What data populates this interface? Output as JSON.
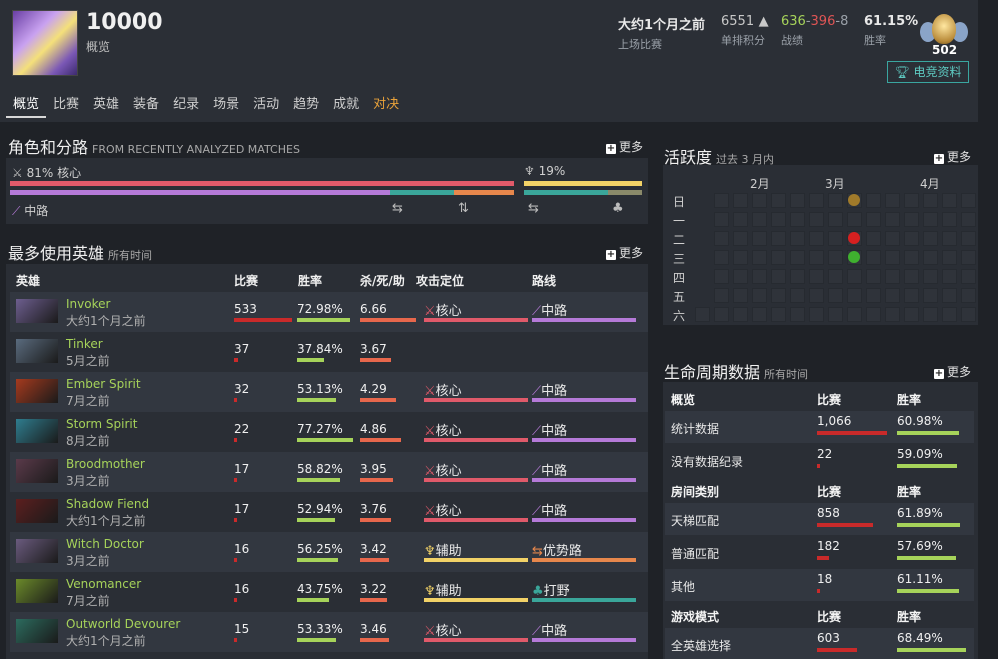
{
  "player": {
    "name": "10000",
    "subtitle": "概览"
  },
  "stats": {
    "last_match": {
      "value": "大约1个月之前",
      "label": "上场比赛"
    },
    "solo_mmr": {
      "value": "6551",
      "label": "单排积分"
    },
    "record": {
      "wins": "636",
      "losses": "396",
      "abandons": "8",
      "label": "战绩"
    },
    "winrate": {
      "value": "61.15%",
      "label": "胜率"
    },
    "rank_number": "502",
    "esports_button": "电竞资料"
  },
  "tabs": [
    "概览",
    "比赛",
    "英雄",
    "装备",
    "纪录",
    "场景",
    "活动",
    "趋势",
    "成就",
    "对决"
  ],
  "roles": {
    "title": "角色和分路",
    "subtitle": "FROM RECENTLY ANALYZED MATCHES",
    "more": "更多",
    "core_label": "81% 核心",
    "support_label": "19%",
    "lane_label": "中路",
    "colors": {
      "core": "#e05a6a",
      "mid": "#b57ad8",
      "support": "#f2d267",
      "jungle": "#3aa69a",
      "safe": "#e7874c"
    }
  },
  "heroes": {
    "title": "最多使用英雄",
    "subtitle": "所有时间",
    "more": "更多",
    "columns": [
      "英雄",
      "比赛",
      "胜率",
      "杀/死/助",
      "攻击定位",
      "路线"
    ],
    "rows": [
      {
        "name": "Invoker",
        "time": "大约1个月之前",
        "matches": "533",
        "matches_pct": 1.0,
        "winrate": "72.98%",
        "winrate_pct": 0.7298,
        "kda": "6.66",
        "kda_pct": 1.0,
        "role": "核心",
        "role_kind": "core",
        "lane": "中路",
        "lane_kind": "mid",
        "img": "#6d5e8f"
      },
      {
        "name": "Tinker",
        "time": "5月之前",
        "matches": "37",
        "matches_pct": 0.07,
        "winrate": "37.84%",
        "winrate_pct": 0.3784,
        "kda": "3.67",
        "kda_pct": 0.55,
        "role": "",
        "role_kind": "",
        "lane": "",
        "lane_kind": "",
        "img": "#5a6b7e"
      },
      {
        "name": "Ember Spirit",
        "time": "7月之前",
        "matches": "32",
        "matches_pct": 0.06,
        "winrate": "53.13%",
        "winrate_pct": 0.5313,
        "kda": "4.29",
        "kda_pct": 0.64,
        "role": "核心",
        "role_kind": "core",
        "lane": "中路",
        "lane_kind": "mid",
        "img": "#a53a1e"
      },
      {
        "name": "Storm Spirit",
        "time": "8月之前",
        "matches": "22",
        "matches_pct": 0.04,
        "winrate": "77.27%",
        "winrate_pct": 0.7727,
        "kda": "4.86",
        "kda_pct": 0.73,
        "role": "核心",
        "role_kind": "core",
        "lane": "中路",
        "lane_kind": "mid",
        "img": "#2f7d8f"
      },
      {
        "name": "Broodmother",
        "time": "3月之前",
        "matches": "17",
        "matches_pct": 0.03,
        "winrate": "58.82%",
        "winrate_pct": 0.5882,
        "kda": "3.95",
        "kda_pct": 0.59,
        "role": "核心",
        "role_kind": "core",
        "lane": "中路",
        "lane_kind": "mid",
        "img": "#5a3a4a"
      },
      {
        "name": "Shadow Fiend",
        "time": "大约1个月之前",
        "matches": "17",
        "matches_pct": 0.03,
        "winrate": "52.94%",
        "winrate_pct": 0.5294,
        "kda": "3.76",
        "kda_pct": 0.56,
        "role": "核心",
        "role_kind": "core",
        "lane": "中路",
        "lane_kind": "mid",
        "img": "#5c1f1f"
      },
      {
        "name": "Witch Doctor",
        "time": "3月之前",
        "matches": "16",
        "matches_pct": 0.03,
        "winrate": "56.25%",
        "winrate_pct": 0.5625,
        "kda": "3.42",
        "kda_pct": 0.51,
        "role": "辅助",
        "role_kind": "support",
        "lane": "优势路",
        "lane_kind": "safe",
        "img": "#6a5b7e"
      },
      {
        "name": "Venomancer",
        "time": "7月之前",
        "matches": "16",
        "matches_pct": 0.03,
        "winrate": "43.75%",
        "winrate_pct": 0.4375,
        "kda": "3.22",
        "kda_pct": 0.48,
        "role": "辅助",
        "role_kind": "support",
        "lane": "打野",
        "lane_kind": "jungle",
        "img": "#6b8a2a"
      },
      {
        "name": "Outworld Devourer",
        "time": "大约1个月之前",
        "matches": "15",
        "matches_pct": 0.03,
        "winrate": "53.33%",
        "winrate_pct": 0.5333,
        "kda": "3.46",
        "kda_pct": 0.52,
        "role": "核心",
        "role_kind": "core",
        "lane": "中路",
        "lane_kind": "mid",
        "img": "#2c6b5e"
      }
    ]
  },
  "activity": {
    "title": "活跃度",
    "subtitle": "过去 3 月内",
    "more": "更多",
    "months": [
      "2月",
      "3月",
      "4月"
    ],
    "days": [
      "日",
      "一",
      "二",
      "三",
      "四",
      "五",
      "六"
    ]
  },
  "lifetime": {
    "title": "生命周期数据",
    "subtitle": "所有时间",
    "more": "更多",
    "sections": [
      {
        "header": "概览",
        "col1": "比赛",
        "col2": "胜率",
        "rows": [
          {
            "label": "统计数据",
            "matches": "1,066",
            "winrate": "60.98%",
            "m_pct": 1.0,
            "w_pct": 0.61
          },
          {
            "label": "没有数据纪录",
            "matches": "22",
            "winrate": "59.09%",
            "m_pct": 0.02,
            "w_pct": 0.59
          }
        ]
      },
      {
        "header": "房间类别",
        "col1": "比赛",
        "col2": "胜率",
        "rows": [
          {
            "label": "天梯匹配",
            "matches": "858",
            "winrate": "61.89%",
            "m_pct": 0.8,
            "w_pct": 0.62
          },
          {
            "label": "普通匹配",
            "matches": "182",
            "winrate": "57.69%",
            "m_pct": 0.17,
            "w_pct": 0.58
          },
          {
            "label": "其他",
            "matches": "18",
            "winrate": "61.11%",
            "m_pct": 0.02,
            "w_pct": 0.61
          }
        ]
      },
      {
        "header": "游戏模式",
        "col1": "比赛",
        "col2": "胜率",
        "rows": [
          {
            "label": "全英雄选择",
            "matches": "603",
            "winrate": "68.49%",
            "m_pct": 0.57,
            "w_pct": 0.68
          }
        ]
      }
    ]
  }
}
